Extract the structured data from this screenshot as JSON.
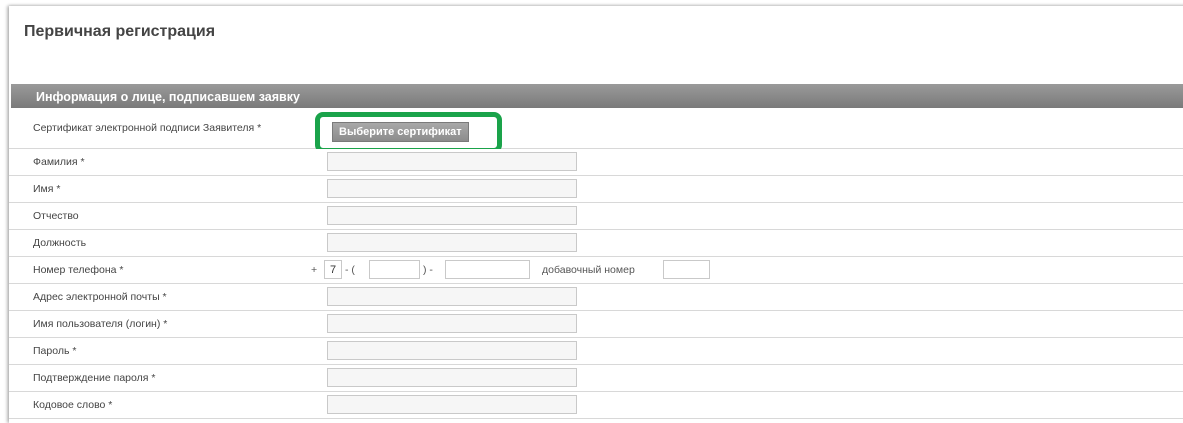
{
  "page": {
    "title": "Первичная регистрация"
  },
  "section": {
    "header": "Информация о лице, подписавшем заявку"
  },
  "certificate": {
    "label": "Сертификат электронной подписи Заявителя *",
    "button_label": "Выберите сертификат",
    "highlight_color": "#1aa34a"
  },
  "fields": {
    "surname_label": "Фамилия *",
    "name_label": "Имя *",
    "patronymic_label": "Отчество",
    "position_label": "Должность",
    "phone_label": "Номер телефона *",
    "email_label": "Адрес электронной почты *",
    "login_label": "Имя пользователя (логин) *",
    "password_label": "Пароль *",
    "password_confirm_label": "Подтверждение пароля *",
    "codeword_label": "Кодовое слово *"
  },
  "phone": {
    "plus": "+",
    "country_code": "7",
    "sep1": "- (",
    "sep2": ") -",
    "extension_label": "добавочный номер"
  }
}
